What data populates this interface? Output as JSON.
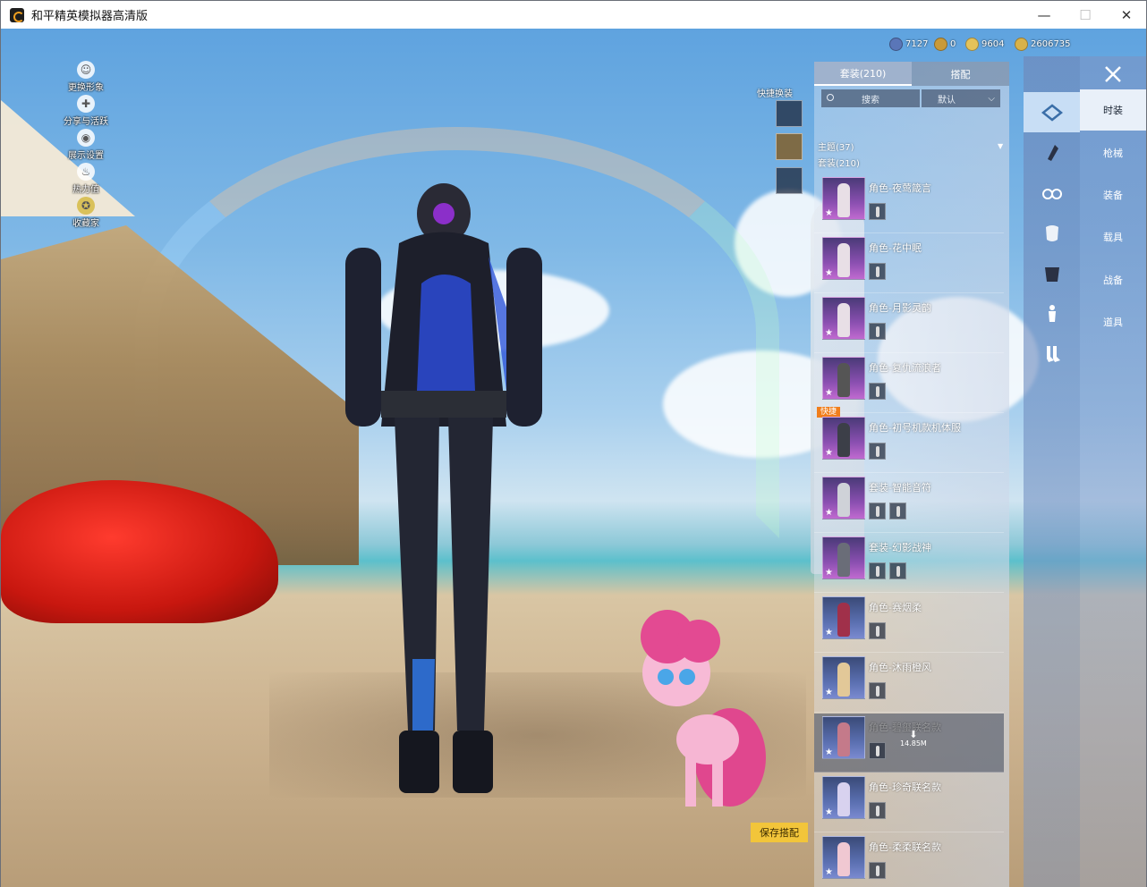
{
  "window": {
    "title": "和平精英模拟器高清版",
    "controls": {
      "minimize": "—",
      "maximize": "☐",
      "close": "✕"
    }
  },
  "left_menu": [
    {
      "label": "更换形象",
      "icon": "person-icon"
    },
    {
      "label": "分享与活跃",
      "icon": "share-icon"
    },
    {
      "label": "展示设置",
      "icon": "eye-icon"
    },
    {
      "label": "热力值",
      "icon": "flame-icon"
    },
    {
      "label": "收藏家",
      "icon": "badge-icon"
    }
  ],
  "currencies": [
    {
      "value": "7127",
      "color": "#5a76b8"
    },
    {
      "value": "0",
      "color": "#c99a3a"
    },
    {
      "value": "9604",
      "color": "#e4c25a"
    },
    {
      "value": "2606735",
      "color": "#d9b24a"
    }
  ],
  "quick_change": {
    "label": "快捷换装"
  },
  "panel": {
    "tabs": [
      {
        "label": "套装(210)"
      },
      {
        "label": "搭配"
      }
    ],
    "search_placeholder": "搜索",
    "sort_label": "默认",
    "groups": [
      {
        "label": "主题(37)"
      },
      {
        "label": "套装(210)"
      }
    ],
    "items": [
      {
        "name": "角色-夜莺箴言"
      },
      {
        "name": "角色-花中眠"
      },
      {
        "name": "角色-月影灵韵"
      },
      {
        "name": "角色-复仇流浪者"
      },
      {
        "name": "角色-初号机款机体服",
        "badge": "快捷"
      },
      {
        "name": "套装-智能音符"
      },
      {
        "name": "套装-幻影战神"
      },
      {
        "name": "角色-赛烟柔"
      },
      {
        "name": "角色-沐雨橙风"
      },
      {
        "name": "角色-碧玺联名款",
        "download_size": "14.85M"
      },
      {
        "name": "角色-珍奇联名款"
      },
      {
        "name": "角色-柔柔联名款"
      }
    ]
  },
  "categories": [
    {
      "label": "时装",
      "icon": "outfit-icon"
    },
    {
      "label": "枪械",
      "icon": "gun-icon"
    },
    {
      "label": "装备",
      "icon": "goggles-icon"
    },
    {
      "label": "载具",
      "icon": "mask-icon"
    },
    {
      "label": "战备",
      "icon": "armor-icon"
    },
    {
      "label": "道具",
      "icon": "figure-icon"
    },
    {
      "label": "",
      "icon": "socks-icon"
    }
  ],
  "save_button": {
    "label": "保存搭配"
  }
}
